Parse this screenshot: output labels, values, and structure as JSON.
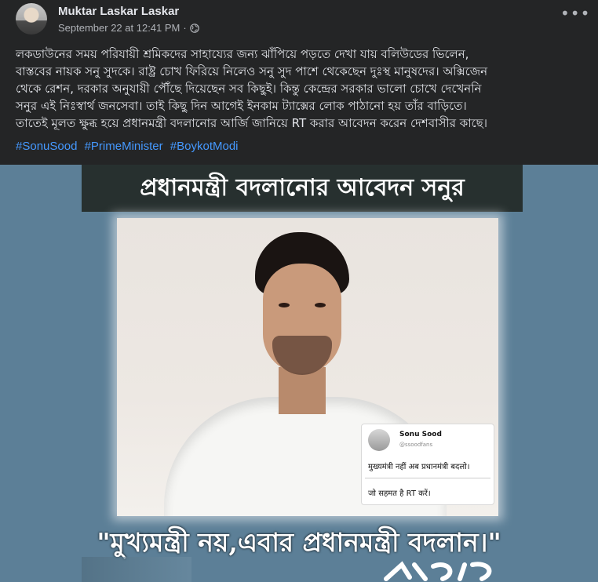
{
  "post": {
    "author": "Muktar Laskar Laskar",
    "timestamp": "September 22 at 12:41 PM",
    "separator": "·",
    "more_label": "•••",
    "body_lines": [
      "লকডাউনের সময় পরিযায়ী শ্রমিকদের সাহায্যের জন্য ঝাঁপিয়ে পড়তে দেখা যায় বলিউডের ভিলেন,",
      "বাস্তবের নায়ক সনু সুদকে। রাষ্ট্র চোখ ফিরিয়ে নিলেও সনু সুদ পাশে থেকেছেন দুঃস্থ মানুষদের। অক্সিজেন",
      "থেকে রেশন, দরকার অনুযায়ী পৌঁছে দিয়েছেন সব কিছুই। কিন্তু কেন্দ্রের সরকার ভালো চোখে দেখেননি",
      "সনুর এই নিঃস্বার্থ জনসেবা। তাই কিছু দিন আগেই ইনকাম ট্যাক্সের লোক পাঠানো হয় তাঁর বাড়িতে।",
      "তাতেই মূলত ক্ষুব্ধ হয়ে প্রধানমন্ত্রী বদলানোর আর্জি জানিয়ে RT করার আবেদন করেন দেশবাসীর কাছে।"
    ],
    "hashtags": [
      "#SonuSood",
      "#PrimeMinister",
      "#BoykotModi"
    ]
  },
  "image": {
    "banner": "প্রধানমন্ত্রী বদলানোর আবেদন সনুর",
    "quote": "\"মুখ্যমন্ত্রী নয়,এবার প্রধানমন্ত্রী বদলান।\"",
    "signature": "সনু সুদ",
    "tweet": {
      "name": "Sonu Sood",
      "handle": "@ssoodfans",
      "line1": "मुख्यमंत्री नहीं अब प्रधानमंत्री बदलो।",
      "line2": "जो सहमत है RT करें।"
    }
  },
  "colors": {
    "background": "#242526",
    "hashtag": "#4599ff",
    "image_bg": "#5c7f97",
    "banner_bg": "#27302f"
  }
}
